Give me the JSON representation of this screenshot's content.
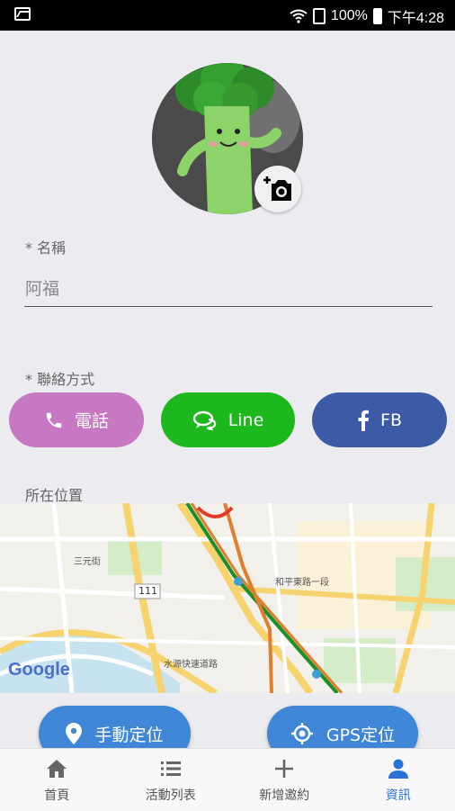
{
  "status_bar": {
    "battery": "100%",
    "time": "下午4:28"
  },
  "form": {
    "name_label": "* 名稱",
    "name_value": "阿福",
    "contact_label": "* 聯絡方式",
    "location_label": "所在位置"
  },
  "contact_buttons": {
    "phone": "電話",
    "line": "Line",
    "fb": "FB"
  },
  "map": {
    "road_label_1": "三元街",
    "road_label_2": "和平東路一段",
    "road_label_3": "111",
    "road_label_4": "水源快速道路",
    "watermark": "Google"
  },
  "location_buttons": {
    "manual": "手動定位",
    "gps": "GPS定位"
  },
  "tabbar": {
    "items": [
      {
        "label": "首頁",
        "icon": "home-icon"
      },
      {
        "label": "活動列表",
        "icon": "list-icon"
      },
      {
        "label": "新增邀約",
        "icon": "plus-icon"
      },
      {
        "label": "資訊",
        "icon": "person-icon",
        "active": true
      }
    ]
  },
  "colors": {
    "phone": "#c678c2",
    "line": "#1db81d",
    "fb": "#3d5aa7",
    "primary": "#3f86d6",
    "active_tab": "#2a73d6"
  }
}
